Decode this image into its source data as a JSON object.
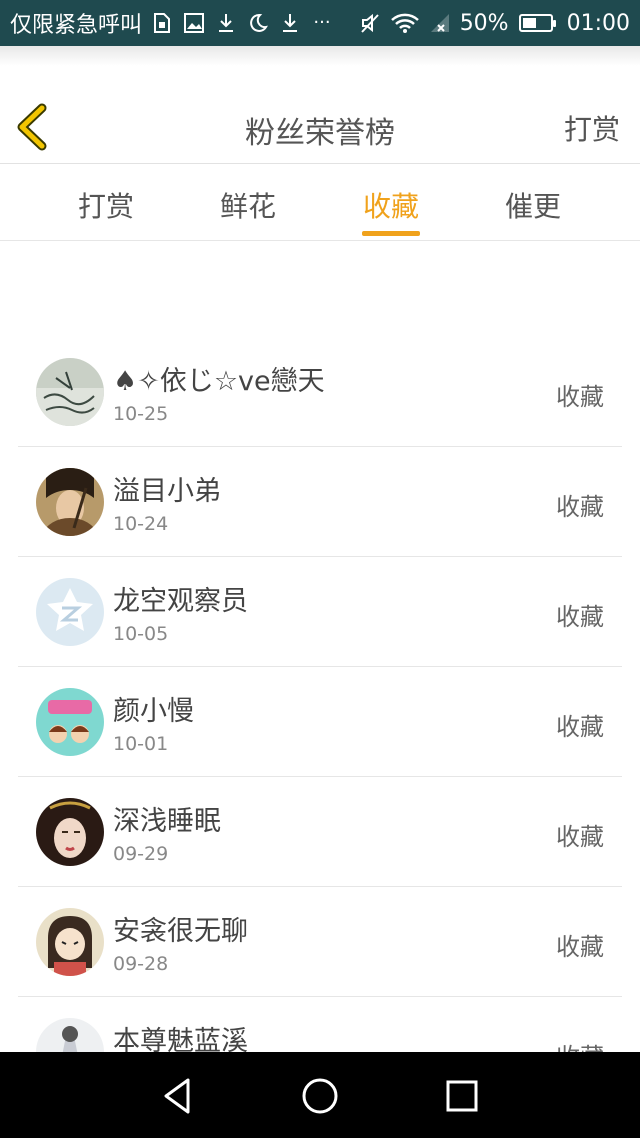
{
  "status_bar": {
    "carrier": "仅限紧急呼叫",
    "icons": [
      "sim-icon",
      "image-icon",
      "download-icon",
      "moon-icon",
      "download-icon",
      "more-dots-icon",
      "mute-icon",
      "wifi-icon",
      "signal-icon"
    ],
    "more": "···",
    "battery_percent": "50%",
    "battery_level": 0.5,
    "time": "01:00"
  },
  "header": {
    "back_icon": "chevron-left-icon",
    "title": "粉丝荣誉榜",
    "action_label": "打赏"
  },
  "tabs": [
    {
      "label": "打赏",
      "active": false
    },
    {
      "label": "鲜花",
      "active": false
    },
    {
      "label": "收藏",
      "active": true
    },
    {
      "label": "催更",
      "active": false
    }
  ],
  "colors": {
    "accent": "#f0a21c",
    "status_bar": "#1f4a4f"
  },
  "fans": [
    {
      "name": "♠✧依じ☆ve戀天",
      "date": "10-25",
      "action": "收藏"
    },
    {
      "name": "溢目小弟",
      "date": "10-24",
      "action": "收藏"
    },
    {
      "name": "龙空观察员",
      "date": "10-05",
      "action": "收藏"
    },
    {
      "name": "颜小慢",
      "date": "10-01",
      "action": "收藏"
    },
    {
      "name": "深浅睡眠",
      "date": "09-29",
      "action": "收藏"
    },
    {
      "name": "安衾很无聊",
      "date": "09-28",
      "action": "收藏"
    },
    {
      "name": "本尊魅蓝溪",
      "date": "",
      "action": "收藏"
    }
  ],
  "nav_bar": {
    "back_icon": "triangle-back-icon",
    "home_icon": "circle-home-icon",
    "recents_icon": "square-recents-icon"
  }
}
